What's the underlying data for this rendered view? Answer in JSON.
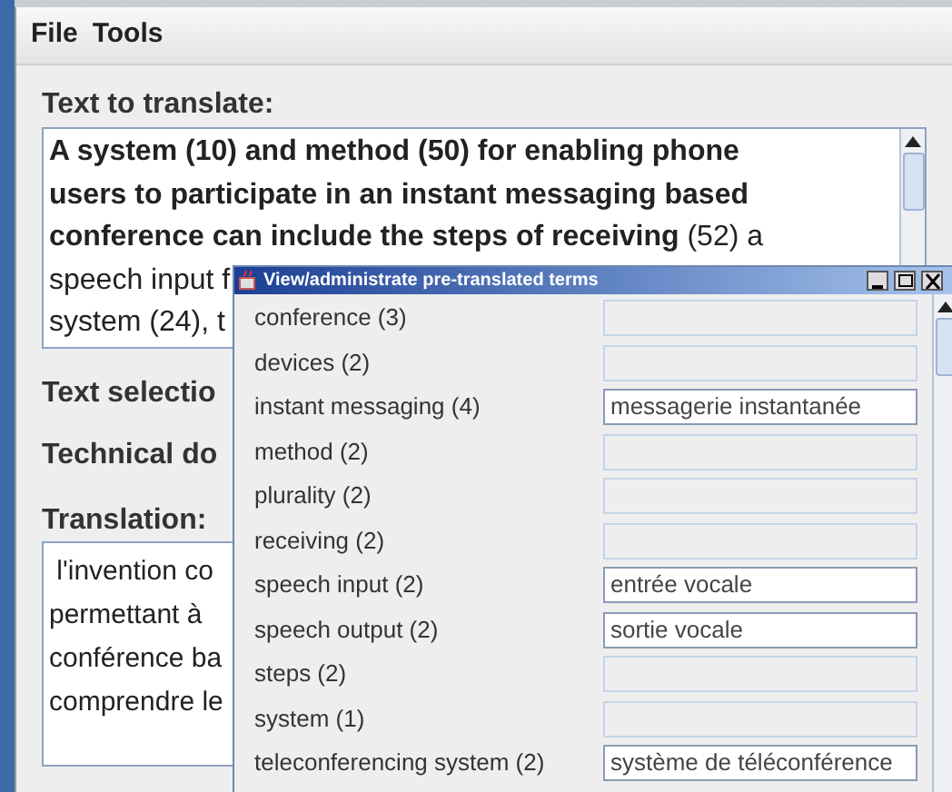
{
  "menu": [
    "File",
    "Tools"
  ],
  "source": {
    "label": "Text to translate:",
    "lines": [
      {
        "text": "A system (10) and method (50) for enabling phone",
        "bold": true
      },
      {
        "text": "users to participate in an instant messaging based",
        "bold": true
      },
      {
        "text": "**conference can include the steps of receiving** (52) a",
        "bold": false
      },
      {
        "text": "speech input f",
        "bold": false
      },
      {
        "text": "system (24), t",
        "bold": false
      }
    ]
  },
  "labels": [
    "Text selectio",
    "Technical do"
  ],
  "translation": {
    "label": "Translation:",
    "lines": [
      " l'invention co",
      "permettant à",
      "conférence ba",
      "comprendre le"
    ]
  },
  "dialog": {
    "title": "View/administrate pre-translated terms",
    "terms": [
      {
        "term": "conference (3)",
        "enabled": false
      },
      {
        "term": "devices (2)",
        "enabled": false
      },
      {
        "term": "instant messaging (4)",
        "enabled": true,
        "value": "messagerie instantanée"
      },
      {
        "term": "method (2)",
        "enabled": false
      },
      {
        "term": "plurality (2)",
        "enabled": false
      },
      {
        "term": "receiving (2)",
        "enabled": false
      },
      {
        "term": "speech input (2)",
        "enabled": true,
        "value": "entrée vocale"
      },
      {
        "term": "speech output (2)",
        "enabled": true,
        "value": "sortie vocale"
      },
      {
        "term": "steps (2)",
        "enabled": false
      },
      {
        "term": "system (1)",
        "enabled": false
      },
      {
        "term": "teleconferencing system (2)",
        "enabled": true,
        "value": "système de téléconférence"
      }
    ]
  }
}
